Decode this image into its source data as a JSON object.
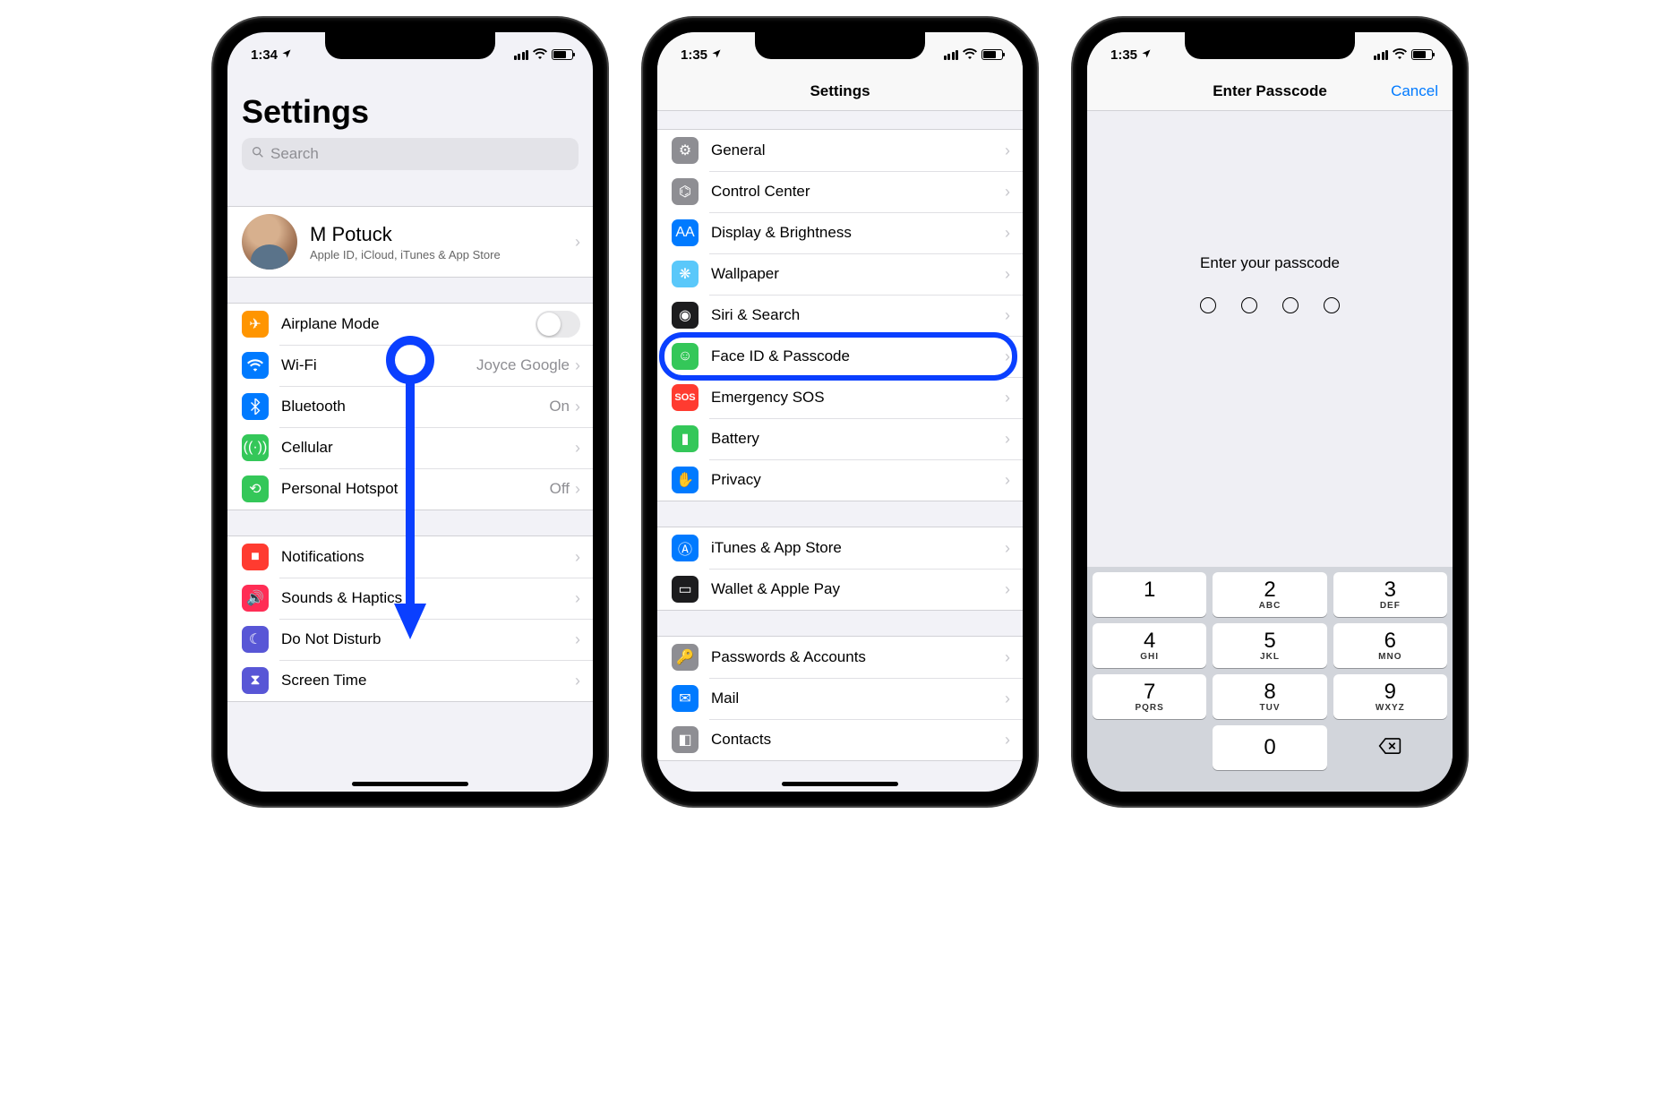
{
  "screens": [
    {
      "status_time": "1:34",
      "title": "Settings",
      "search_placeholder": "Search",
      "profile": {
        "name": "M Potuck",
        "sub": "Apple ID, iCloud, iTunes & App Store"
      },
      "group1": [
        {
          "icon": "airplane-icon",
          "color": "bg-orange",
          "label": "Airplane Mode",
          "accessory": "switch"
        },
        {
          "icon": "wifi-icon",
          "color": "bg-blue",
          "label": "Wi-Fi",
          "detail": "Joyce Google",
          "accessory": "disclosure"
        },
        {
          "icon": "bluetooth-icon",
          "color": "bg-blue",
          "label": "Bluetooth",
          "detail": "On",
          "accessory": "disclosure"
        },
        {
          "icon": "cellular-icon",
          "color": "bg-green",
          "label": "Cellular",
          "accessory": "disclosure"
        },
        {
          "icon": "hotspot-icon",
          "color": "bg-green",
          "label": "Personal Hotspot",
          "detail": "Off",
          "accessory": "disclosure"
        }
      ],
      "group2": [
        {
          "icon": "notifications-icon",
          "color": "bg-red",
          "label": "Notifications",
          "accessory": "disclosure"
        },
        {
          "icon": "sounds-icon",
          "color": "bg-rose",
          "label": "Sounds & Haptics",
          "accessory": "disclosure"
        },
        {
          "icon": "dnd-icon",
          "color": "bg-purple",
          "label": "Do Not Disturb",
          "accessory": "disclosure"
        },
        {
          "icon": "screentime-icon",
          "color": "bg-purple",
          "label": "Screen Time",
          "accessory": "disclosure"
        }
      ]
    },
    {
      "status_time": "1:35",
      "navbar_title": "Settings",
      "groupA": [
        {
          "icon": "general-icon",
          "color": "bg-gray",
          "label": "General"
        },
        {
          "icon": "controlcenter-icon",
          "color": "bg-gray",
          "label": "Control Center"
        },
        {
          "icon": "display-icon",
          "color": "bg-blue",
          "label": "Display & Brightness"
        },
        {
          "icon": "wallpaper-icon",
          "color": "bg-teal",
          "label": "Wallpaper"
        },
        {
          "icon": "siri-icon",
          "color": "bg-dark",
          "label": "Siri & Search"
        },
        {
          "icon": "faceid-icon",
          "color": "bg-green",
          "label": "Face ID & Passcode",
          "highlight": true
        },
        {
          "icon": "sos-icon",
          "color": "bg-sos",
          "label": "Emergency SOS",
          "iconText": "SOS"
        },
        {
          "icon": "battery-icon",
          "color": "bg-green",
          "label": "Battery"
        },
        {
          "icon": "privacy-icon",
          "color": "bg-blue",
          "label": "Privacy"
        }
      ],
      "groupB": [
        {
          "icon": "appstore-icon",
          "color": "bg-blue",
          "label": "iTunes & App Store"
        },
        {
          "icon": "wallet-icon",
          "color": "bg-dark",
          "label": "Wallet & Apple Pay"
        }
      ],
      "groupC": [
        {
          "icon": "passwords-icon",
          "color": "bg-gray",
          "label": "Passwords & Accounts"
        },
        {
          "icon": "mail-icon",
          "color": "bg-blue",
          "label": "Mail"
        },
        {
          "icon": "contacts-icon",
          "color": "bg-gray",
          "label": "Contacts"
        }
      ]
    },
    {
      "status_time": "1:35",
      "navbar_title": "Enter Passcode",
      "cancel": "Cancel",
      "prompt": "Enter your passcode",
      "keys": [
        {
          "n": "1",
          "l": ""
        },
        {
          "n": "2",
          "l": "ABC"
        },
        {
          "n": "3",
          "l": "DEF"
        },
        {
          "n": "4",
          "l": "GHI"
        },
        {
          "n": "5",
          "l": "JKL"
        },
        {
          "n": "6",
          "l": "MNO"
        },
        {
          "n": "7",
          "l": "PQRS"
        },
        {
          "n": "8",
          "l": "TUV"
        },
        {
          "n": "9",
          "l": "WXYZ"
        }
      ],
      "zero": "0"
    }
  ]
}
